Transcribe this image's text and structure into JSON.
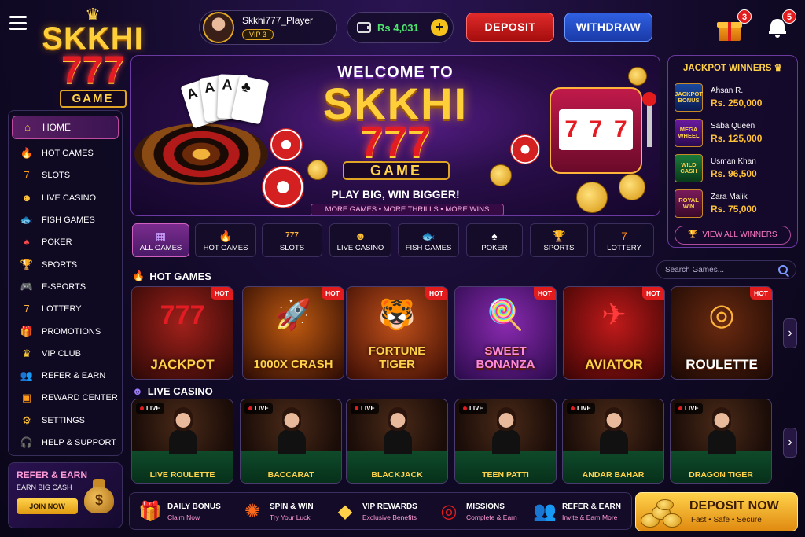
{
  "header": {
    "logo": {
      "line1": "SKKHI",
      "line2": "777",
      "line3": "GAME"
    },
    "user": {
      "name": "Skkhi777_Player",
      "vip": "VIP 3"
    },
    "wallet": {
      "balance": "Rs 4,031",
      "add": "+"
    },
    "deposit_label": "DEPOSIT",
    "withdraw_label": "WITHDRAW",
    "gift_count": "3",
    "notification_count": "5"
  },
  "sidebar": {
    "items": [
      {
        "label": "HOME",
        "icon": "home-icon",
        "glyph": "⌂"
      },
      {
        "label": "HOT GAMES",
        "icon": "fire-icon",
        "glyph": "🔥"
      },
      {
        "label": "SLOTS",
        "icon": "slot-icon",
        "glyph": "7"
      },
      {
        "label": "LIVE CASINO",
        "icon": "dealer-icon",
        "glyph": "☻"
      },
      {
        "label": "FISH GAMES",
        "icon": "fish-icon",
        "glyph": "🐟"
      },
      {
        "label": "POKER",
        "icon": "cards-icon",
        "glyph": "♠"
      },
      {
        "label": "SPORTS",
        "icon": "trophy-icon",
        "glyph": "🏆"
      },
      {
        "label": "E-SPORTS",
        "icon": "gamepad-icon",
        "glyph": "🎮"
      },
      {
        "label": "LOTTERY",
        "icon": "lottery-icon",
        "glyph": "7"
      },
      {
        "label": "PROMOTIONS",
        "icon": "gift-icon",
        "glyph": "🎁"
      },
      {
        "label": "VIP CLUB",
        "icon": "crown-icon",
        "glyph": "♛"
      },
      {
        "label": "REFER & EARN",
        "icon": "users-icon",
        "glyph": "👥"
      },
      {
        "label": "REWARD CENTER",
        "icon": "reward-icon",
        "glyph": "▣"
      },
      {
        "label": "SETTINGS",
        "icon": "gear-icon",
        "glyph": "⚙"
      },
      {
        "label": "HELP & SUPPORT",
        "icon": "headset-icon",
        "glyph": "🎧"
      }
    ],
    "refer": {
      "title": "REFER & EARN",
      "subtitle": "EARN BIG CASH",
      "button": "JOIN NOW"
    }
  },
  "banner": {
    "welcome": "WELCOME TO",
    "name": "SKKHI",
    "number": "777",
    "game": "GAME",
    "tagline": "PLAY BIG, WIN BIGGER!",
    "more": "MORE GAMES  •  MORE THRILLS  •  MORE WINS"
  },
  "jackpot": {
    "title": "JACKPOT WINNERS",
    "winners": [
      {
        "name": "Ahsan R.",
        "amount": "Rs. 250,000",
        "game": "JACKPOT BONUS"
      },
      {
        "name": "Saba Queen",
        "amount": "Rs. 125,000",
        "game": "MEGA WHEEL"
      },
      {
        "name": "Usman Khan",
        "amount": "Rs. 96,500",
        "game": "WILD CASH"
      },
      {
        "name": "Zara Malik",
        "amount": "Rs. 75,000",
        "game": "ROYAL WIN"
      }
    ],
    "view_all": "VIEW ALL WINNERS"
  },
  "categories": [
    {
      "label": "ALL GAMES",
      "glyph": "▦"
    },
    {
      "label": "HOT GAMES",
      "glyph": "🔥"
    },
    {
      "label": "SLOTS",
      "glyph": "777"
    },
    {
      "label": "LIVE CASINO",
      "glyph": "☻"
    },
    {
      "label": "FISH GAMES",
      "glyph": "🐟"
    },
    {
      "label": "POKER",
      "glyph": "♠"
    },
    {
      "label": "SPORTS",
      "glyph": "🏆"
    },
    {
      "label": "LOTTERY",
      "glyph": "7"
    }
  ],
  "search": {
    "placeholder": "Search Games..."
  },
  "hot_games": {
    "title": "HOT GAMES",
    "badge": "HOT",
    "games": [
      {
        "name": "JACKPOT",
        "art": "777"
      },
      {
        "name": "1000X CRASH",
        "art": "🚀"
      },
      {
        "name": "FORTUNE TIGER",
        "art": "🐯"
      },
      {
        "name": "SWEET BONANZA",
        "art": "🍭"
      },
      {
        "name": "AVIATOR",
        "art": "✈"
      },
      {
        "name": "ROULETTE",
        "art": "◎"
      }
    ]
  },
  "live_casino": {
    "title": "LIVE CASINO",
    "badge": "LIVE",
    "games": [
      "LIVE ROULETTE",
      "BACCARAT",
      "BLACKJACK",
      "TEEN PATTI",
      "ANDAR BAHAR",
      "DRAGON TIGER"
    ]
  },
  "promos": [
    {
      "title": "DAILY BONUS",
      "sub": "Claim Now",
      "glyph": "🎁"
    },
    {
      "title": "SPIN & WIN",
      "sub": "Try Your Luck",
      "glyph": "✺"
    },
    {
      "title": "VIP REWARDS",
      "sub": "Exclusive Benefits",
      "glyph": "◆"
    },
    {
      "title": "MISSIONS",
      "sub": "Complete & Earn",
      "glyph": "◎"
    },
    {
      "title": "REFER & EARN",
      "sub": "Invite & Earn More",
      "glyph": "👥"
    }
  ],
  "deposit_now": {
    "title": "DEPOSIT NOW",
    "sub": "Fast • Safe • Secure"
  }
}
